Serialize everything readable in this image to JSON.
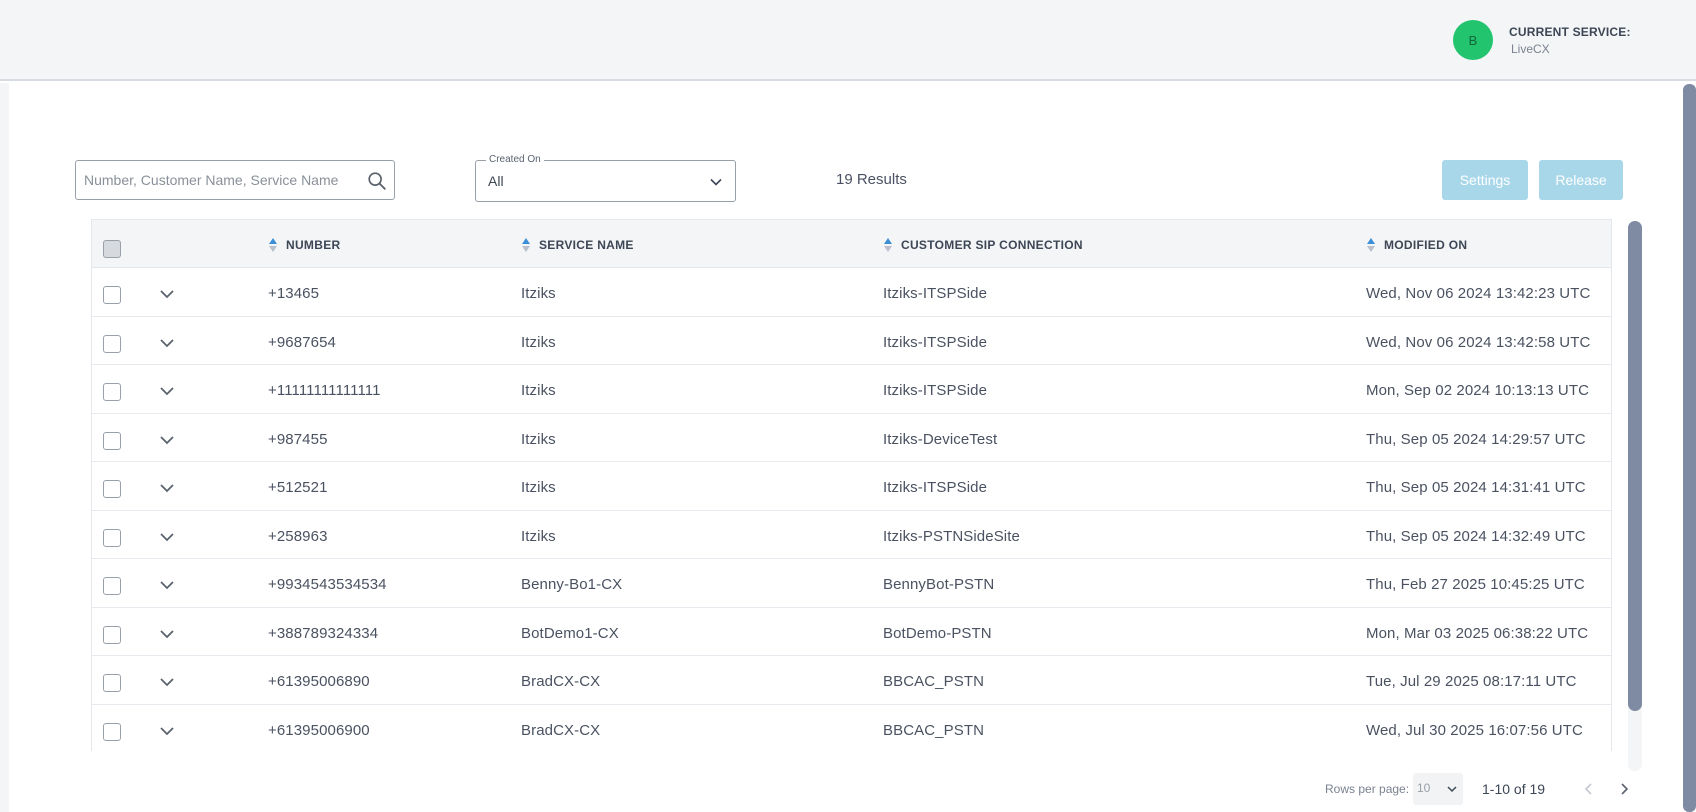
{
  "header": {
    "avatar_letter": "B",
    "service_title": "CURRENT SERVICE:",
    "service_value": "LiveCX"
  },
  "filters": {
    "search_placeholder": "Number, Customer Name, Service Name",
    "created_on_label": "Created On",
    "created_on_value": "All",
    "results_text": "19 Results"
  },
  "actions": {
    "settings_label": "Settings",
    "release_label": "Release"
  },
  "table": {
    "columns": {
      "number": "NUMBER",
      "service_name": "SERVICE NAME",
      "customer_sip": "CUSTOMER SIP CONNECTION",
      "modified_on": "MODIFIED ON"
    },
    "rows": [
      {
        "number": "+13465",
        "service": "Itziks",
        "sip": "Itziks-ITSPSide",
        "modified": "Wed, Nov 06 2024 13:42:23 UTC"
      },
      {
        "number": "+9687654",
        "service": "Itziks",
        "sip": "Itziks-ITSPSide",
        "modified": "Wed, Nov 06 2024 13:42:58 UTC"
      },
      {
        "number": "+11111111111111",
        "service": "Itziks",
        "sip": "Itziks-ITSPSide",
        "modified": "Mon, Sep 02 2024 10:13:13 UTC"
      },
      {
        "number": "+987455",
        "service": "Itziks",
        "sip": "Itziks-DeviceTest",
        "modified": "Thu, Sep 05 2024 14:29:57 UTC"
      },
      {
        "number": "+512521",
        "service": "Itziks",
        "sip": "Itziks-ITSPSide",
        "modified": "Thu, Sep 05 2024 14:31:41 UTC"
      },
      {
        "number": "+258963",
        "service": "Itziks",
        "sip": "Itziks-PSTNSideSite",
        "modified": "Thu, Sep 05 2024 14:32:49 UTC"
      },
      {
        "number": "+9934543534534",
        "service": "Benny-Bo1-CX",
        "sip": "BennyBot-PSTN",
        "modified": "Thu, Feb 27 2025 10:45:25 UTC"
      },
      {
        "number": "+388789324334",
        "service": "BotDemo1-CX",
        "sip": "BotDemo-PSTN",
        "modified": "Mon, Mar 03 2025 06:38:22 UTC"
      },
      {
        "number": "+61395006890",
        "service": "BradCX-CX",
        "sip": "BBCAC_PSTN",
        "modified": "Tue, Jul 29 2025 08:17:11 UTC"
      },
      {
        "number": "+61395006900",
        "service": "BradCX-CX",
        "sip": "BBCAC_PSTN",
        "modified": "Wed, Jul 30 2025 16:07:56 UTC"
      }
    ]
  },
  "pagination": {
    "rows_per_page_label": "Rows per page:",
    "rows_per_page_value": "10",
    "range_text": "1-10 of 19"
  },
  "colors": {
    "avatar": "#22c46e",
    "button_disabled": "#a9d7ea",
    "sort_icon": "#3b8fd6",
    "scrollbar": "#7f8aa3"
  }
}
